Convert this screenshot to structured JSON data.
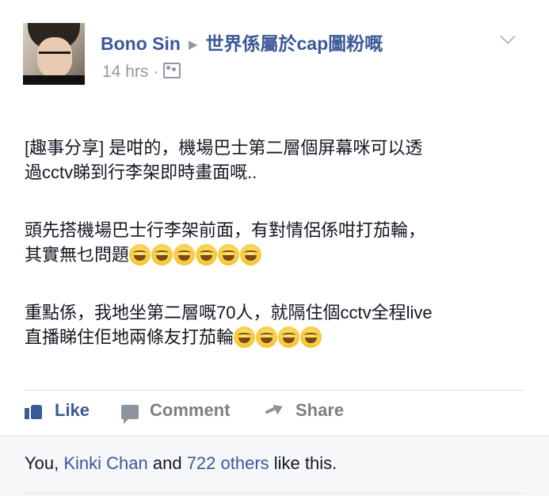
{
  "post": {
    "author": "Bono Sin",
    "separator": "▶",
    "group": "世界係屬於cap圖粉嘅",
    "time": "14 hrs",
    "dot": "·",
    "audience_icon": "group-audience-icon",
    "message": {
      "paragraph1": "[趣事分享] 是咁的，機場巴士第二層個屏幕咪可以透過cctv睇到行李架即時畫面嘅..",
      "paragraph1_line1": "[趣事分享] 是咁的，機場巴士第二層個屏幕咪可以透",
      "paragraph1_line2": "過cctv睇到行李架即時畫面嘅..",
      "paragraph2_line1": "頭先搭機場巴士行李架前面，有對情侶係咁打茄輪，",
      "paragraph2_line2": "其實無乜問題",
      "paragraph2_emoji_count": 6,
      "paragraph3_line1": "重點係，我地坐第二層嘅70人，就隔住個cctv全程live",
      "paragraph3_line2": "直播睇住佢地兩條友打茄輪",
      "paragraph3_emoji_count": 4,
      "emoji_name": "tears-of-joy-emoji"
    }
  },
  "actions": {
    "like": "Like",
    "comment": "Comment",
    "share": "Share"
  },
  "likes": {
    "prefix": "You, ",
    "friend": "Kinki Chan",
    "and": " and ",
    "others": "722 others",
    "suffix": " like this."
  },
  "colors": {
    "link": "#3b5998",
    "secondary": "#9197a3",
    "text": "#141823",
    "footer_bg": "#f6f7f9"
  }
}
